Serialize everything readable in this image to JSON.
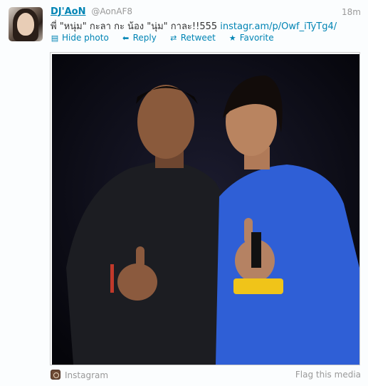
{
  "tweet": {
    "display_name": "DJ'AoN",
    "handle": "@AonAF8",
    "timestamp": "18m",
    "text": "พี่ \"หนุ่ม\" กะลา กะ น้อง \"นุ่ม\" กาละ!!555 ",
    "link": "instagr.am/p/Owf_iTyTg4/"
  },
  "actions": {
    "hide_photo": "Hide photo",
    "reply": "Reply",
    "retweet": "Retweet",
    "favorite": "Favorite"
  },
  "media": {
    "source": "Instagram",
    "flag": "Flag this media"
  },
  "icons": [
    "photo-icon",
    "reply-icon",
    "retweet-icon",
    "star-icon",
    "instagram-icon"
  ],
  "colors": {
    "link": "#0084b4",
    "muted": "#999999",
    "shirt_blue": "#2f5fd6"
  }
}
